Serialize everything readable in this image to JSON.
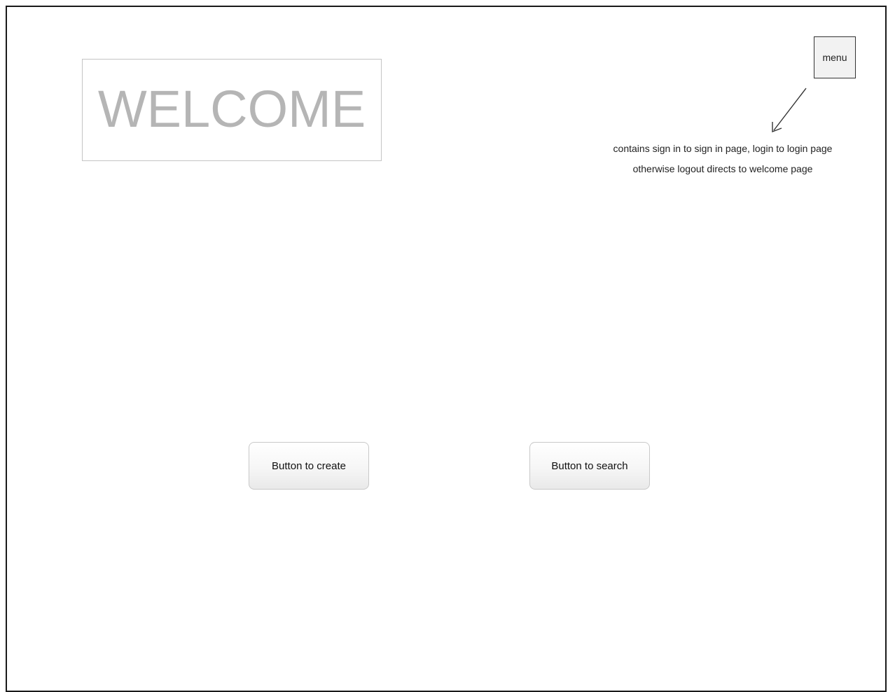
{
  "welcome": {
    "title": "WELCOME"
  },
  "menu": {
    "label": "menu"
  },
  "annotation": {
    "line1": "contains sign in to sign in page, login to login page",
    "line2": "otherwise logout directs to welcome page",
    "icon": "arrow-down-left-icon"
  },
  "buttons": {
    "create_label": "Button to create",
    "search_label": "Button to search"
  },
  "colors": {
    "welcome_text": "#b5b5b5",
    "frame_border": "#1a1a1a"
  }
}
